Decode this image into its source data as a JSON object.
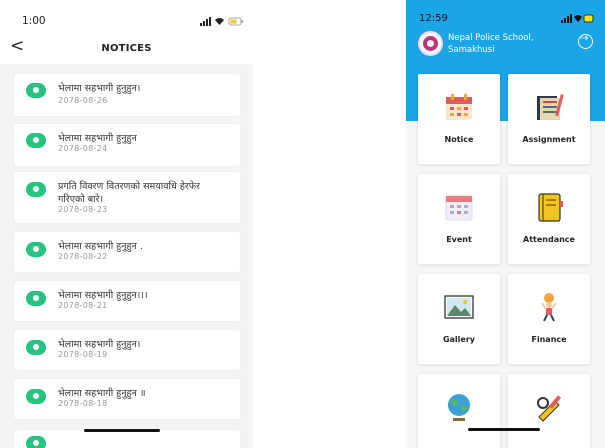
{
  "left": {
    "status_time": "1:00",
    "back_glyph": "<",
    "title": "NOTICES",
    "notices": [
      {
        "title": "भेलामा सहभागी हुनुहुन।",
        "date": "2078-08-26"
      },
      {
        "title": "भेलामा सहभागी हुनुहुन",
        "date": "2078-08-24"
      },
      {
        "title_line1": "प्रगति विवरण वितरणको समयावधि हेरफेर",
        "title_line2": "गरिएको बारे।",
        "date": "2078-08-23"
      },
      {
        "title": "भेलामा सहभागी हुनुहुन .",
        "date": "2078-08-22"
      },
      {
        "title": "भेलामा सहभागी हुनुहुन।।।",
        "date": "2078-08-21"
      },
      {
        "title": "भेलामा सहभागी हुनुहुन।",
        "date": "2078-08-19"
      },
      {
        "title": "भेलामा सहभागी हुनुहुन ॥",
        "date": "2078-08-18"
      }
    ]
  },
  "right": {
    "status_time": "12:59",
    "school_line1": "Nepal Police School,",
    "school_line2": "Samakhusi",
    "tiles": [
      {
        "label": "Notice",
        "icon": "calendar-notice-icon"
      },
      {
        "label": "Assignment",
        "icon": "assignment-book-icon"
      },
      {
        "label": "Event",
        "icon": "event-calendar-icon"
      },
      {
        "label": "Attendance",
        "icon": "attendance-notebook-icon"
      },
      {
        "label": "Gallery",
        "icon": "gallery-picture-icon"
      },
      {
        "label": "Finance",
        "icon": "finance-person-icon"
      },
      {
        "label": "",
        "icon": "globe-icon"
      },
      {
        "label": "",
        "icon": "tools-icon"
      }
    ]
  },
  "colors": {
    "accent_blue": "#1aa5e6",
    "notice_dot": "#27c480"
  }
}
